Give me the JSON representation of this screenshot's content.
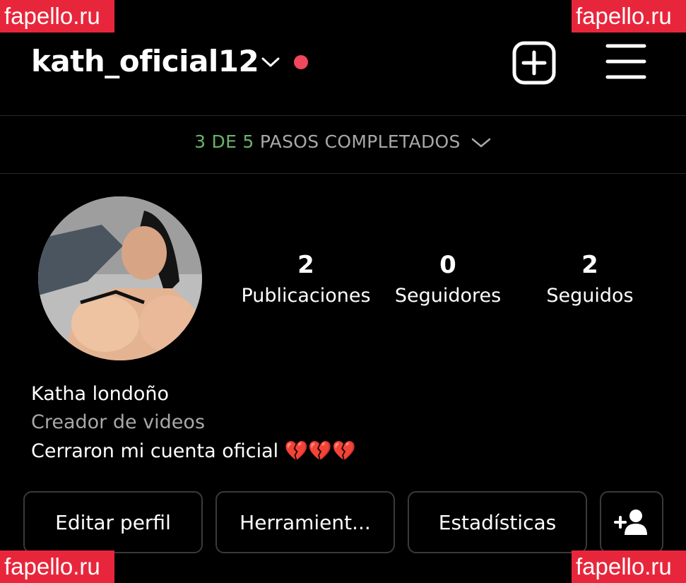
{
  "watermarks": {
    "top_left": "fapello.ru",
    "top_right": "fapello.ru",
    "bottom_left": "fapello.ru",
    "bottom_right": "fapello.ru"
  },
  "header": {
    "username": "kath_oficial12",
    "dropdown_icon": "chevron-down-icon",
    "notification_dot_color": "#f0475c",
    "create_icon": "plus-square-icon",
    "menu_icon": "hamburger-menu-icon"
  },
  "progress": {
    "steps_done": "3 DE 5",
    "steps_label": "PASOS COMPLETADOS",
    "accent_color": "#69b46c",
    "completed": 3,
    "total": 5
  },
  "stats": {
    "posts_count": "2",
    "posts_label": "Publicaciones",
    "followers_count": "0",
    "followers_label": "Seguidores",
    "following_count": "2",
    "following_label": "Seguidos"
  },
  "bio": {
    "name": "Katha londoño",
    "category": "Creador de videos",
    "text": "Cerraron mi cuenta oficial ",
    "emoji": "💔💔💔"
  },
  "buttons": {
    "edit_profile": "Editar perfil",
    "tools": "Herramient...",
    "insights": "Estadísticas",
    "add_user_icon": "add-user-icon"
  }
}
